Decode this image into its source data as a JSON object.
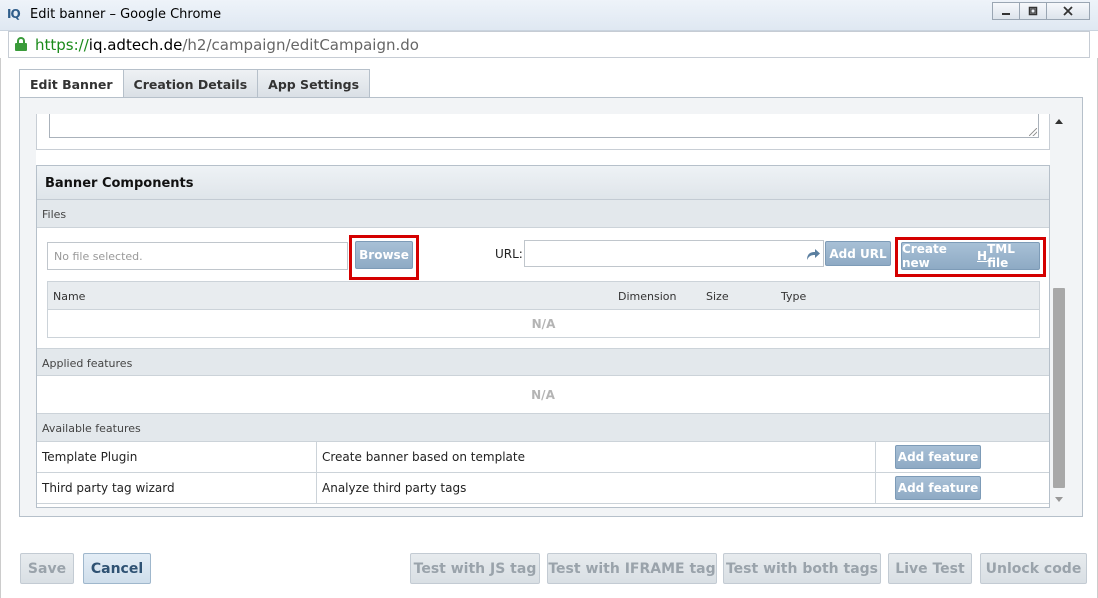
{
  "window": {
    "app_icon": "IQ",
    "title": "Edit banner – Google Chrome",
    "controls": [
      "minimize-icon",
      "restore-icon",
      "close-icon"
    ]
  },
  "address": {
    "scheme": "https://",
    "host": "iq.adtech.de",
    "path": "/h2/campaign/editCampaign.do"
  },
  "tabs": [
    {
      "label": "Edit Banner",
      "active": true
    },
    {
      "label": "Creation Details",
      "active": false
    },
    {
      "label": "App Settings",
      "active": false
    }
  ],
  "banner_components": {
    "title": "Banner Components",
    "files_label": "Files",
    "file_input_placeholder": "No file selected.",
    "browse_label": "Browse",
    "url_label": "URL:",
    "url_value": "",
    "add_url_label": "Add URL",
    "create_html_label_pre": "Create new ",
    "create_html_label_ul": "H",
    "create_html_label_post": "TML file",
    "files_table": {
      "columns": [
        "Name",
        "Dimension",
        "Size",
        "Type"
      ],
      "empty_text": "N/A"
    },
    "applied_features_label": "Applied features",
    "applied_empty_text": "N/A",
    "available_features_label": "Available features",
    "available_features": [
      {
        "name": "Template Plugin",
        "description": "Create banner based on template",
        "action": "Add feature"
      },
      {
        "name": "Third party tag wizard",
        "description": "Analyze third party tags",
        "action": "Add feature"
      }
    ]
  },
  "footer": {
    "save": "Save",
    "cancel": "Cancel",
    "test_js": "Test with JS tag",
    "test_iframe": "Test with IFRAME tag",
    "test_both": "Test with both tags",
    "live_test": "Live Test",
    "unlock_code": "Unlock code"
  },
  "colors": {
    "highlight": "#d40000",
    "button_blue": "#8eaac4",
    "secure_green": "#1a8a1a"
  }
}
